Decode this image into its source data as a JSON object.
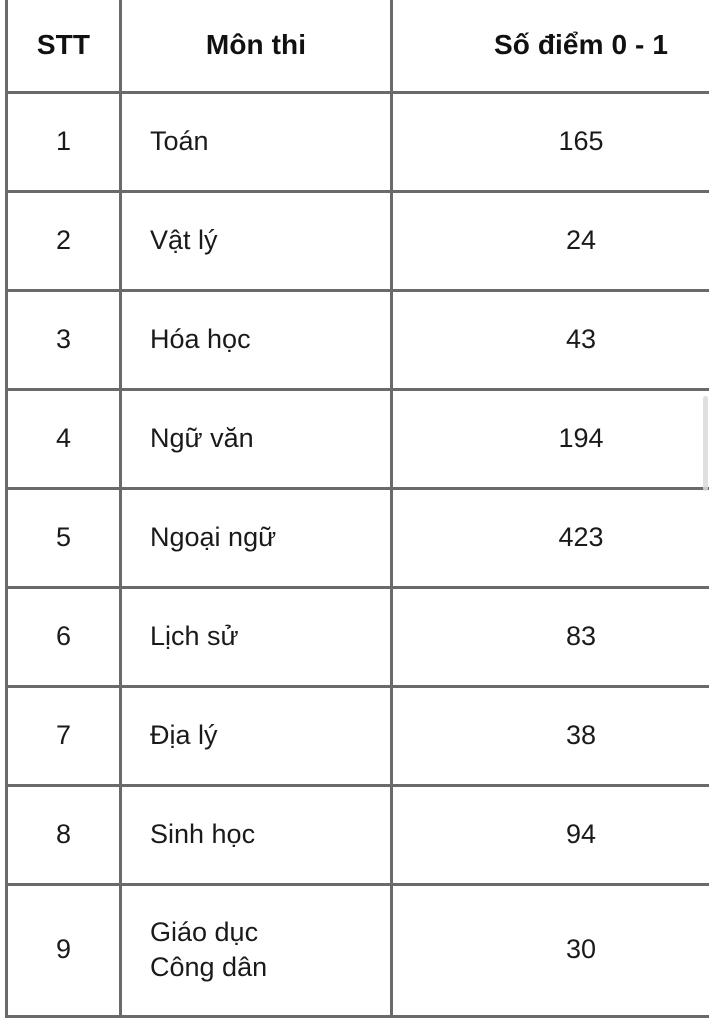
{
  "table": {
    "columns": [
      {
        "key": "stt",
        "label": "STT",
        "align": "center"
      },
      {
        "key": "subject",
        "label": "Môn thi",
        "align": "center"
      },
      {
        "key": "score",
        "label": "Số điểm 0 - 1",
        "align": "center"
      }
    ],
    "rows": [
      {
        "stt": "1",
        "subject": "Toán",
        "score": "165"
      },
      {
        "stt": "2",
        "subject": "Vật lý",
        "score": "24"
      },
      {
        "stt": "3",
        "subject": "Hóa học",
        "score": "43"
      },
      {
        "stt": "4",
        "subject": "Ngữ văn",
        "score": "194"
      },
      {
        "stt": "5",
        "subject": "Ngoại ngữ",
        "score": "423"
      },
      {
        "stt": "6",
        "subject": "Lịch sử",
        "score": "83"
      },
      {
        "stt": "7",
        "subject": "Địa lý",
        "score": "38"
      },
      {
        "stt": "8",
        "subject": "Sinh học",
        "score": "94"
      },
      {
        "stt": "9",
        "subject": "Giáo dục\nCông dân",
        "score": "30"
      }
    ]
  },
  "chart_data": {
    "type": "table",
    "title": "Số điểm 0 - 1",
    "columns": [
      "STT",
      "Môn thi",
      "Số điểm 0 - 1"
    ],
    "categories": [
      "Toán",
      "Vật lý",
      "Hóa học",
      "Ngữ văn",
      "Ngoại ngữ",
      "Lịch sử",
      "Địa lý",
      "Sinh học",
      "Giáo dục Công dân"
    ],
    "values": [
      165,
      24,
      43,
      194,
      423,
      83,
      38,
      94,
      30
    ],
    "xlabel": "Môn thi",
    "ylabel": "Số điểm 0 - 1"
  },
  "colors": {
    "border": "#6a6a6a",
    "header_text": "#111111",
    "body_text": "#1a1a1a",
    "background": "#ffffff",
    "scrollbar_thumb": "#d9d9d9"
  },
  "scrollbar": {
    "name": "vertical-scrollbar"
  }
}
